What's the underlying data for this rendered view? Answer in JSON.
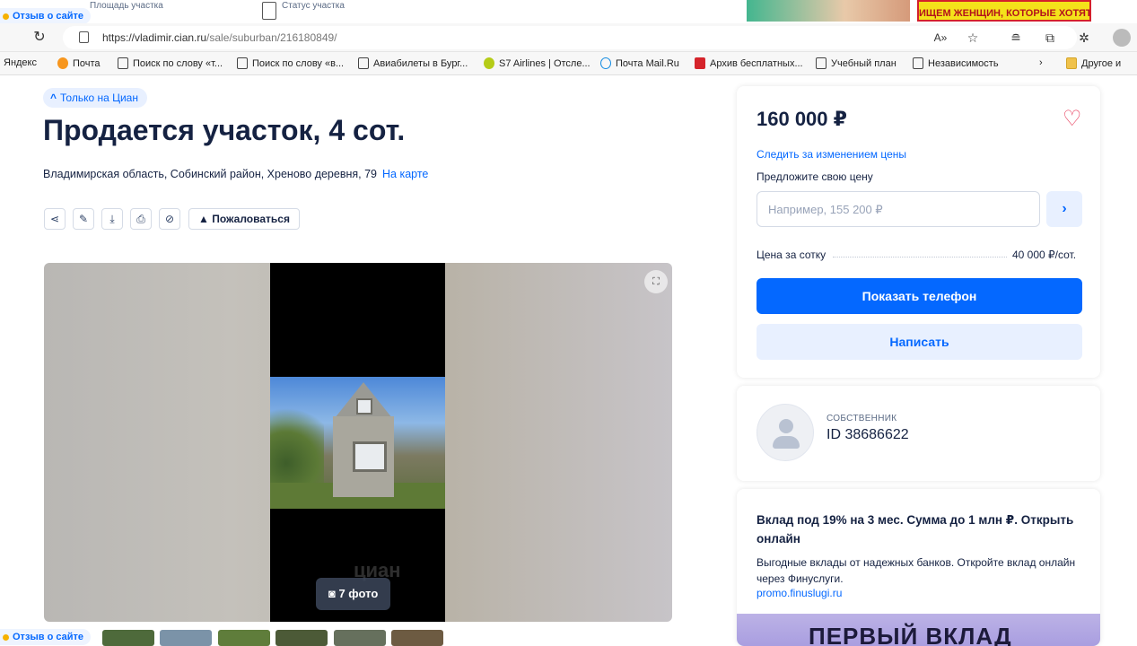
{
  "top_strip": {
    "feedback_label": "Отзыв о сайте",
    "area_label": "Площадь участка",
    "status_label": "Статус участка",
    "ad_banner_text": "ИЩЕМ ЖЕНЩИН, КОТОРЫЕ ХОТЯТ"
  },
  "browser": {
    "url_host": "https://vladimir.cian.ru",
    "url_path": "/sale/suburban/216180849/",
    "bookmarks": [
      {
        "label": "Яндекс"
      },
      {
        "label": "Почта"
      },
      {
        "label": "Поиск по слову «т..."
      },
      {
        "label": "Поиск по слову «в..."
      },
      {
        "label": "Авиабилеты в Бург..."
      },
      {
        "label": "S7 Airlines | Отсле..."
      },
      {
        "label": "Почта Mail.Ru"
      },
      {
        "label": "Архив бесплатных..."
      },
      {
        "label": "Учебный план"
      },
      {
        "label": "Независимость"
      },
      {
        "label": "Другое и"
      }
    ]
  },
  "listing": {
    "badge": "Только на Циан",
    "title": "Продается участок, 4 сот.",
    "address": "Владимирская область, Собинский район, Хреново деревня, 79",
    "map_link": "На карте",
    "complain_label": "Пожаловаться",
    "photo_count": "7 фото",
    "watermark": "циан"
  },
  "price_card": {
    "price": "160 000 ₽",
    "track_price": "Следить за изменением цены",
    "offer_label": "Предложите свою цену",
    "offer_placeholder": "Например, 155 200 ₽",
    "price_per_unit_label": "Цена за сотку",
    "price_per_unit_value": "40 000 ₽/сот.",
    "show_phone": "Показать телефон",
    "write": "Написать"
  },
  "owner": {
    "type": "СОБСТВЕННИК",
    "id": "ID 38686622"
  },
  "ad": {
    "title": "Вклад под 19% на 3 мес. Сумма до 1 млн ₽. Открыть онлайн",
    "text": "Выгодные вклады от надежных банков. Откройте вклад онлайн через Финуслуги.",
    "link": "promo.finuslugi.ru",
    "banner": "ПЕРВЫЙ ВКЛАД"
  },
  "colors": {
    "accent": "#0468ff",
    "accent_light": "#e8f0ff",
    "text": "#152242",
    "heart": "#e84260"
  }
}
